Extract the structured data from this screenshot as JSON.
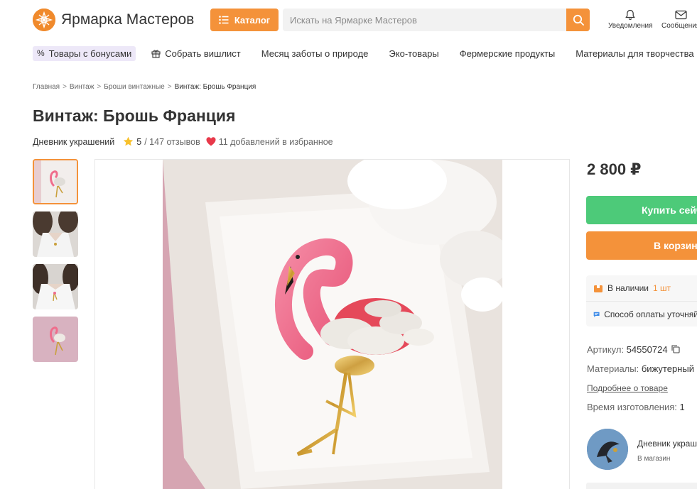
{
  "header": {
    "logo_text": "Ярмарка Мастеров",
    "catalog_label": "Каталог",
    "search_placeholder": "Искать на Ярмарке Мастеров",
    "notifications_label": "Уведомления",
    "messages_label": "Сообщения"
  },
  "nav": {
    "items": [
      "Товары с бонусами",
      "Собрать вишлист",
      "Месяц заботы о природе",
      "Эко-товары",
      "Фермерские продукты",
      "Материалы для творчества"
    ]
  },
  "breadcrumb": [
    "Главная",
    "Винтаж",
    "Броши винтажные",
    "Винтаж: Брошь Франция"
  ],
  "product": {
    "title": "Винтаж: Брошь Франция",
    "shop": "Дневник украшений",
    "rating": "5",
    "reviews": "/ 147 отзывов",
    "favorites": "11 добавлений в избранное"
  },
  "buy": {
    "price": "2 800 ₽",
    "buy_now": "Купить сейчас",
    "add_to_cart": "В корзину",
    "stock_label": "В наличии",
    "stock_qty": "1 шт",
    "payment": "Способ оплаты уточняйте"
  },
  "props": {
    "article_label": "Артикул:",
    "article_value": "54550724",
    "materials_label": "Материалы:",
    "materials_value": "бижутерный сплав",
    "details_link": "Подробнее о товаре",
    "production_label": "Время изготовления:",
    "production_value": "1"
  },
  "seller": {
    "name": "Дневник украшений",
    "sub": "В магазин"
  },
  "colors": {
    "accent": "#f4923a",
    "buy": "#4dca79"
  }
}
